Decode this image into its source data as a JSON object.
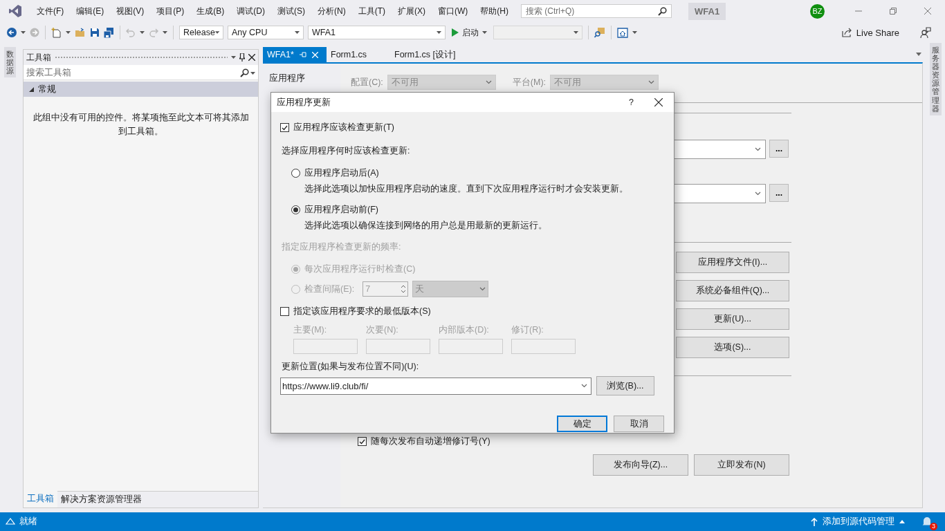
{
  "menu_bar": {
    "items": [
      "文件(F)",
      "编辑(E)",
      "视图(V)",
      "项目(P)",
      "生成(B)",
      "调试(D)",
      "测试(S)",
      "分析(N)",
      "工具(T)",
      "扩展(X)",
      "窗口(W)",
      "帮助(H)"
    ],
    "search": {
      "placeholder": "搜索 (Ctrl+Q)"
    },
    "solution_name": "WFA1",
    "avatar": "BZ"
  },
  "toolbar": {
    "configuration": "Release",
    "platform": "Any CPU",
    "startup_project": "WFA1",
    "start_label": "启动",
    "live_share": "Live Share"
  },
  "left_tab": "数据源",
  "toolbox": {
    "title": "工具箱",
    "search": {
      "placeholder": "搜索工具箱"
    },
    "groups": [
      {
        "label": "常规",
        "expanded": true,
        "empty_text": "此组中没有可用的控件。将某项拖至此文本可将其添加到工具箱。"
      }
    ],
    "bottom_tabs": [
      {
        "label": "工具箱",
        "selected": true
      },
      {
        "label": "解决方案资源管理器",
        "selected": false
      }
    ]
  },
  "document_tabs": [
    {
      "label": "WFA1*",
      "selected": true
    },
    {
      "label": "Form1.cs",
      "selected": false
    },
    {
      "label": "Form1.cs [设计]",
      "selected": false
    }
  ],
  "properties": {
    "nav": [
      {
        "label": "应用程序",
        "selected": false
      }
    ],
    "config_label": "配置(C):",
    "config_value": "不可用",
    "platform_label": "平台(M):",
    "platform_value": "不可用",
    "ellipsis_buttons": [
      "...",
      "..."
    ],
    "buttons": [
      "应用程序文件(I)...",
      "系统必备组件(Q)...",
      "更新(U)...",
      "选项(S)..."
    ],
    "auto_increment": {
      "label": "随每次发布自动递增修订号(Y)",
      "checked": true
    },
    "footer_buttons": [
      "发布向导(Z)...",
      "立即发布(N)"
    ]
  },
  "right_tab": "服务器资源管理器",
  "dialog": {
    "title": "应用程序更新",
    "help": "?",
    "check_updates": {
      "label": "应用程序应该检查更新(T)",
      "checked": true
    },
    "when_label": "选择应用程序何时应该检查更新:",
    "timing_options": [
      {
        "label": "应用程序启动后(A)",
        "description": "选择此选项以加快应用程序启动的速度。直到下次应用程序运行时才会安装更新。",
        "selected": false
      },
      {
        "label": "应用程序启动前(F)",
        "description": "选择此选项以确保连接到网络的用户总是用最新的更新运行。",
        "selected": true
      }
    ],
    "frequency_label": "指定应用程序检查更新的频率:",
    "frequency_disabled": true,
    "frequency_options": [
      {
        "label": "每次应用程序运行时检查(C)",
        "selected": true
      },
      {
        "label": "检查间隔(E):",
        "selected": false
      }
    ],
    "interval_value": "7",
    "interval_unit": "天",
    "min_version": {
      "label": "指定该应用程序要求的最低版本(S)",
      "checked": false,
      "fields": [
        "主要(M):",
        "次要(N):",
        "内部版本(D):",
        "修订(R):"
      ]
    },
    "location_label": "更新位置(如果与发布位置不同)(U):",
    "location_value": "https://www.li9.club/fi/",
    "browse": "浏览(B)...",
    "ok": "确定",
    "cancel": "取消"
  },
  "status_bar": {
    "text": "就绪",
    "source_control": "添加到源代码管理",
    "notifications": "3"
  }
}
